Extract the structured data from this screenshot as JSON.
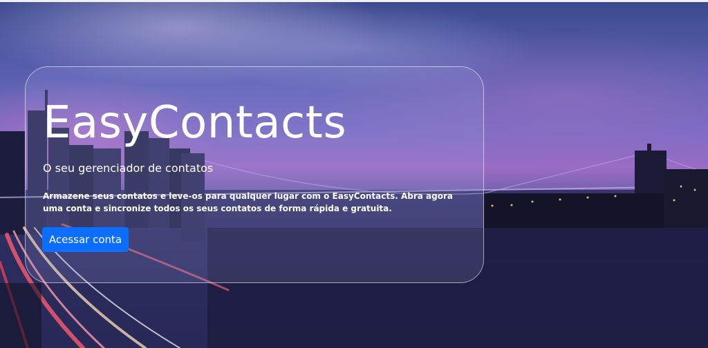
{
  "hero": {
    "brand_title": "EasyContacts",
    "subtitle": "O seu gerenciador de contatos",
    "description": "Armazene seus contatos e leve-os para qualquer lugar com o EasyContacts. Abra agora uma conta e sincronize todos os seus contatos de forma rápida e gratuita.",
    "cta_label": "Acessar conta"
  },
  "colors": {
    "accent": "#0d6efd",
    "text": "#ffffff",
    "card_border": "#ffffffb3"
  },
  "background": {
    "image_subject": "city-skyline-bridge-at-dusk"
  }
}
